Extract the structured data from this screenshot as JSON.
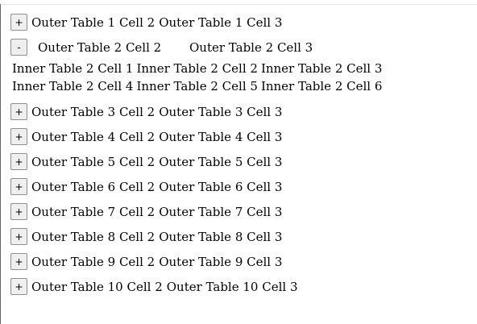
{
  "outer_rows": [
    {
      "id": 1,
      "toggle": "+",
      "cell2": "Outer Table 1 Cell 2",
      "cell3": "Outer Table 1 Cell 3"
    },
    {
      "id": 2,
      "toggle": "-",
      "cell2": "Outer Table 2 Cell 2",
      "cell3": "Outer Table 2 Cell 3",
      "inner": [
        [
          "Inner Table 2 Cell 1",
          "Inner Table 2 Cell 2",
          "Inner Table 2 Cell 3"
        ],
        [
          "Inner Table 2 Cell 4",
          "Inner Table 2 Cell 5",
          "Inner Table 2 Cell 6"
        ]
      ]
    },
    {
      "id": 3,
      "toggle": "+",
      "cell2": "Outer Table 3 Cell 2",
      "cell3": "Outer Table 3 Cell 3"
    },
    {
      "id": 4,
      "toggle": "+",
      "cell2": "Outer Table 4 Cell 2",
      "cell3": "Outer Table 4 Cell 3"
    },
    {
      "id": 5,
      "toggle": "+",
      "cell2": "Outer Table 5 Cell 2",
      "cell3": "Outer Table 5 Cell 3"
    },
    {
      "id": 6,
      "toggle": "+",
      "cell2": "Outer Table 6 Cell 2",
      "cell3": "Outer Table 6 Cell 3"
    },
    {
      "id": 7,
      "toggle": "+",
      "cell2": "Outer Table 7 Cell 2",
      "cell3": "Outer Table 7 Cell 3"
    },
    {
      "id": 8,
      "toggle": "+",
      "cell2": "Outer Table 8 Cell 2",
      "cell3": "Outer Table 8 Cell 3"
    },
    {
      "id": 9,
      "toggle": "+",
      "cell2": "Outer Table 9 Cell 2",
      "cell3": "Outer Table 9 Cell 3"
    },
    {
      "id": 10,
      "toggle": "+",
      "cell2": "Outer Table 10 Cell 2",
      "cell3": "Outer Table 10 Cell 3"
    }
  ]
}
